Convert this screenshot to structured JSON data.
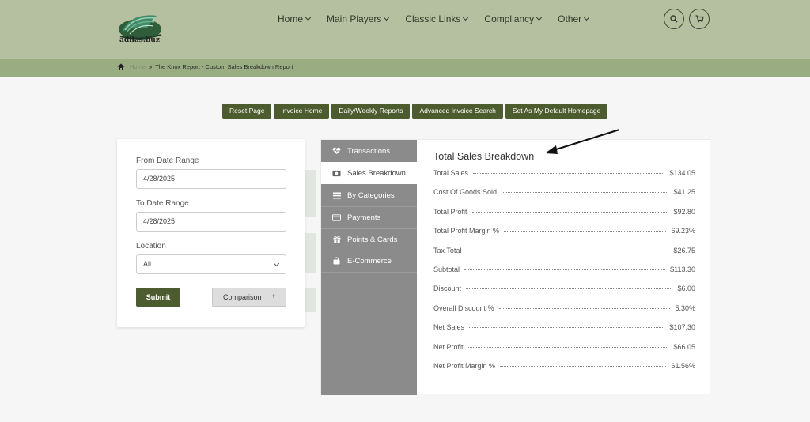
{
  "header": {
    "logo_text": "adilas.buz",
    "nav": [
      "Home",
      "Main Players",
      "Classic Links",
      "Compliancy",
      "Other"
    ]
  },
  "breadcrumb": {
    "home": "Home",
    "current": "The Knox Report - Custom Sales Breakdown Report"
  },
  "actions": [
    "Reset Page",
    "Invoice Home",
    "Daily/Weekly Reports",
    "Advanced Invoice Search",
    "Set As My Default Homepage"
  ],
  "form": {
    "from_label": "From Date Range",
    "from_value": "4/28/2025",
    "to_label": "To Date Range",
    "to_value": "4/28/2025",
    "location_label": "Location",
    "location_value": "All",
    "submit_label": "Submit",
    "comparison_label": "Comparison",
    "comparison_plus": "+"
  },
  "side_menu": [
    {
      "label": "Transactions",
      "icon": "heart-icon",
      "active": false
    },
    {
      "label": "Sales Breakdown",
      "icon": "money-icon",
      "active": true
    },
    {
      "label": "By Categories",
      "icon": "list-icon",
      "active": false
    },
    {
      "label": "Payments",
      "icon": "card-icon",
      "active": false
    },
    {
      "label": "Points & Cards",
      "icon": "gift-icon",
      "active": false
    },
    {
      "label": "E-Commerce",
      "icon": "bag-icon",
      "active": false
    }
  ],
  "breakdown": {
    "title": "Total Sales Breakdown",
    "rows": [
      {
        "label": "Total Sales",
        "value": "$134.05"
      },
      {
        "label": "Cost Of Goods Sold",
        "value": "$41.25"
      },
      {
        "label": "Total Profit",
        "value": "$92.80"
      },
      {
        "label": "Total Profit Margin %",
        "value": "69.23%"
      },
      {
        "label": "Tax Total",
        "value": "$26.75"
      },
      {
        "label": "Subtotal",
        "value": "$113.30"
      },
      {
        "label": "Discount",
        "value": "$6.00"
      },
      {
        "label": "Overall Discount %",
        "value": "5.30%"
      },
      {
        "label": "Net Sales",
        "value": "$107.30"
      },
      {
        "label": "Net Profit",
        "value": "$66.05"
      },
      {
        "label": "Net Profit Margin %",
        "value": "61.56%"
      }
    ]
  },
  "colors": {
    "header": "#b5c0a0",
    "breadcrumb_bar": "#9aac82",
    "button_green": "#4d5c2f",
    "sidebar_gray": "#8b8b8b"
  }
}
